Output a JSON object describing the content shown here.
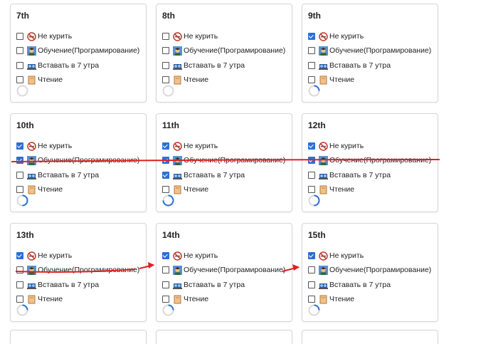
{
  "habits": [
    "Не курить",
    "Обучение(Програмирование)",
    "Вставать в 7 утра",
    "Чтение"
  ],
  "habit_icons": [
    "no-smoking-icon",
    "student-icon",
    "alarm-icon",
    "book-icon"
  ],
  "colors": {
    "accent": "#2b6fd6",
    "ring_track": "#d9d9d9",
    "annotation": "#e02020"
  },
  "days": [
    {
      "label": "7th",
      "checked": [
        false,
        false,
        false,
        false
      ],
      "progress": 0
    },
    {
      "label": "8th",
      "checked": [
        false,
        false,
        false,
        false
      ],
      "progress": 0
    },
    {
      "label": "9th",
      "checked": [
        true,
        false,
        false,
        false
      ],
      "progress": 0.25
    },
    {
      "label": "10th",
      "checked": [
        true,
        true,
        false,
        false
      ],
      "progress": 0.5
    },
    {
      "label": "11th",
      "checked": [
        true,
        true,
        true,
        false
      ],
      "progress": 0.75
    },
    {
      "label": "12th",
      "checked": [
        true,
        true,
        false,
        false
      ],
      "progress": 0.5
    },
    {
      "label": "13th",
      "checked": [
        true,
        false,
        false,
        false
      ],
      "progress": 0.25
    },
    {
      "label": "14th",
      "checked": [
        true,
        false,
        false,
        false
      ],
      "progress": 0.25
    },
    {
      "label": "15th",
      "checked": [
        true,
        false,
        false,
        false
      ],
      "progress": 0.25
    }
  ]
}
